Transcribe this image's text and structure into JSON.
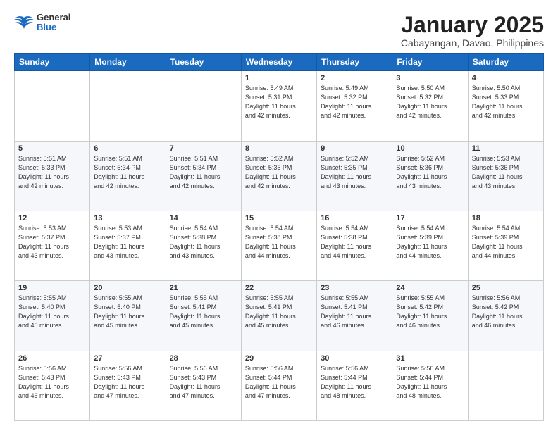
{
  "header": {
    "logo_general": "General",
    "logo_blue": "Blue",
    "month_title": "January 2025",
    "location": "Cabayangan, Davao, Philippines"
  },
  "days_of_week": [
    "Sunday",
    "Monday",
    "Tuesday",
    "Wednesday",
    "Thursday",
    "Friday",
    "Saturday"
  ],
  "weeks": [
    [
      {
        "day": "",
        "info": ""
      },
      {
        "day": "",
        "info": ""
      },
      {
        "day": "",
        "info": ""
      },
      {
        "day": "1",
        "info": "Sunrise: 5:49 AM\nSunset: 5:31 PM\nDaylight: 11 hours\nand 42 minutes."
      },
      {
        "day": "2",
        "info": "Sunrise: 5:49 AM\nSunset: 5:32 PM\nDaylight: 11 hours\nand 42 minutes."
      },
      {
        "day": "3",
        "info": "Sunrise: 5:50 AM\nSunset: 5:32 PM\nDaylight: 11 hours\nand 42 minutes."
      },
      {
        "day": "4",
        "info": "Sunrise: 5:50 AM\nSunset: 5:33 PM\nDaylight: 11 hours\nand 42 minutes."
      }
    ],
    [
      {
        "day": "5",
        "info": "Sunrise: 5:51 AM\nSunset: 5:33 PM\nDaylight: 11 hours\nand 42 minutes."
      },
      {
        "day": "6",
        "info": "Sunrise: 5:51 AM\nSunset: 5:34 PM\nDaylight: 11 hours\nand 42 minutes."
      },
      {
        "day": "7",
        "info": "Sunrise: 5:51 AM\nSunset: 5:34 PM\nDaylight: 11 hours\nand 42 minutes."
      },
      {
        "day": "8",
        "info": "Sunrise: 5:52 AM\nSunset: 5:35 PM\nDaylight: 11 hours\nand 42 minutes."
      },
      {
        "day": "9",
        "info": "Sunrise: 5:52 AM\nSunset: 5:35 PM\nDaylight: 11 hours\nand 43 minutes."
      },
      {
        "day": "10",
        "info": "Sunrise: 5:52 AM\nSunset: 5:36 PM\nDaylight: 11 hours\nand 43 minutes."
      },
      {
        "day": "11",
        "info": "Sunrise: 5:53 AM\nSunset: 5:36 PM\nDaylight: 11 hours\nand 43 minutes."
      }
    ],
    [
      {
        "day": "12",
        "info": "Sunrise: 5:53 AM\nSunset: 5:37 PM\nDaylight: 11 hours\nand 43 minutes."
      },
      {
        "day": "13",
        "info": "Sunrise: 5:53 AM\nSunset: 5:37 PM\nDaylight: 11 hours\nand 43 minutes."
      },
      {
        "day": "14",
        "info": "Sunrise: 5:54 AM\nSunset: 5:38 PM\nDaylight: 11 hours\nand 43 minutes."
      },
      {
        "day": "15",
        "info": "Sunrise: 5:54 AM\nSunset: 5:38 PM\nDaylight: 11 hours\nand 44 minutes."
      },
      {
        "day": "16",
        "info": "Sunrise: 5:54 AM\nSunset: 5:38 PM\nDaylight: 11 hours\nand 44 minutes."
      },
      {
        "day": "17",
        "info": "Sunrise: 5:54 AM\nSunset: 5:39 PM\nDaylight: 11 hours\nand 44 minutes."
      },
      {
        "day": "18",
        "info": "Sunrise: 5:54 AM\nSunset: 5:39 PM\nDaylight: 11 hours\nand 44 minutes."
      }
    ],
    [
      {
        "day": "19",
        "info": "Sunrise: 5:55 AM\nSunset: 5:40 PM\nDaylight: 11 hours\nand 45 minutes."
      },
      {
        "day": "20",
        "info": "Sunrise: 5:55 AM\nSunset: 5:40 PM\nDaylight: 11 hours\nand 45 minutes."
      },
      {
        "day": "21",
        "info": "Sunrise: 5:55 AM\nSunset: 5:41 PM\nDaylight: 11 hours\nand 45 minutes."
      },
      {
        "day": "22",
        "info": "Sunrise: 5:55 AM\nSunset: 5:41 PM\nDaylight: 11 hours\nand 45 minutes."
      },
      {
        "day": "23",
        "info": "Sunrise: 5:55 AM\nSunset: 5:41 PM\nDaylight: 11 hours\nand 46 minutes."
      },
      {
        "day": "24",
        "info": "Sunrise: 5:55 AM\nSunset: 5:42 PM\nDaylight: 11 hours\nand 46 minutes."
      },
      {
        "day": "25",
        "info": "Sunrise: 5:56 AM\nSunset: 5:42 PM\nDaylight: 11 hours\nand 46 minutes."
      }
    ],
    [
      {
        "day": "26",
        "info": "Sunrise: 5:56 AM\nSunset: 5:43 PM\nDaylight: 11 hours\nand 46 minutes."
      },
      {
        "day": "27",
        "info": "Sunrise: 5:56 AM\nSunset: 5:43 PM\nDaylight: 11 hours\nand 47 minutes."
      },
      {
        "day": "28",
        "info": "Sunrise: 5:56 AM\nSunset: 5:43 PM\nDaylight: 11 hours\nand 47 minutes."
      },
      {
        "day": "29",
        "info": "Sunrise: 5:56 AM\nSunset: 5:44 PM\nDaylight: 11 hours\nand 47 minutes."
      },
      {
        "day": "30",
        "info": "Sunrise: 5:56 AM\nSunset: 5:44 PM\nDaylight: 11 hours\nand 48 minutes."
      },
      {
        "day": "31",
        "info": "Sunrise: 5:56 AM\nSunset: 5:44 PM\nDaylight: 11 hours\nand 48 minutes."
      },
      {
        "day": "",
        "info": ""
      }
    ]
  ]
}
